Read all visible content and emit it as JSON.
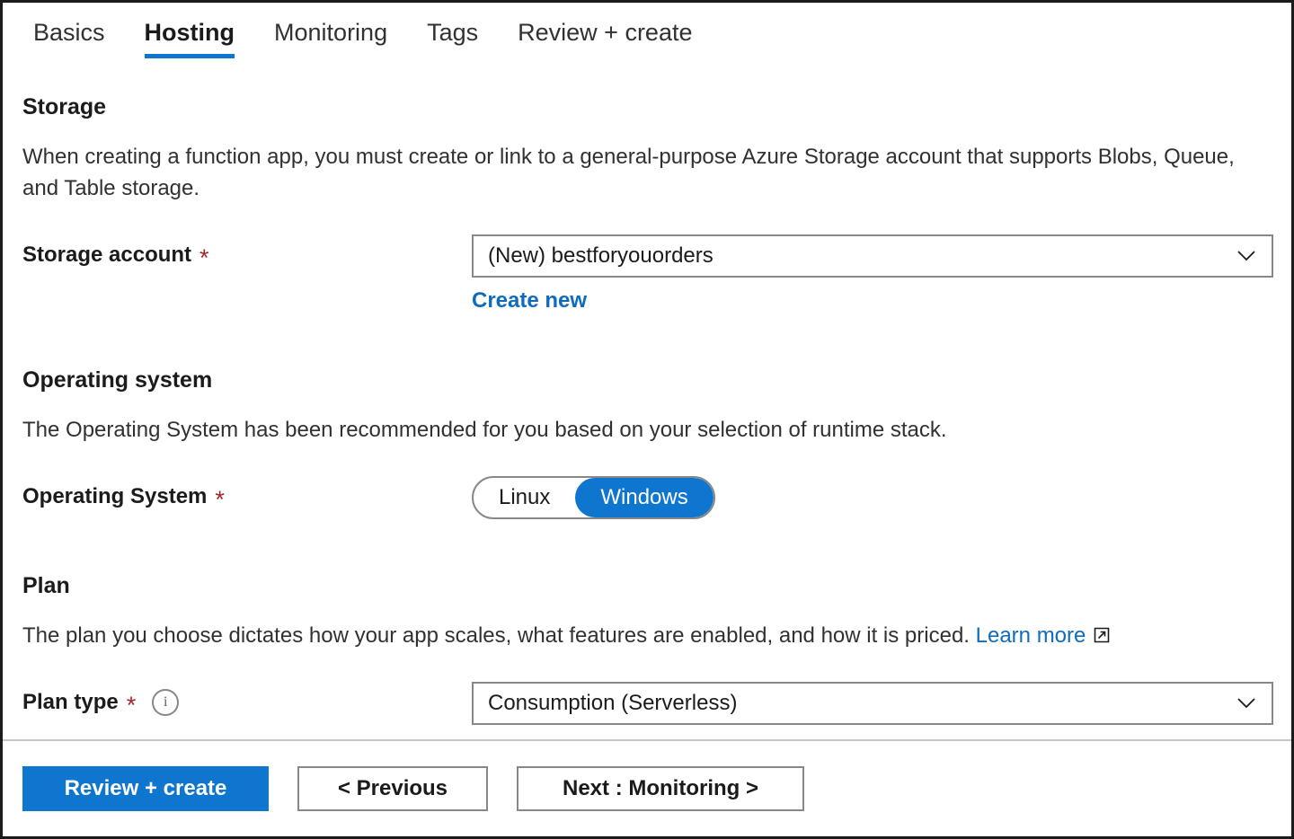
{
  "tabs": [
    {
      "label": "Basics",
      "active": false
    },
    {
      "label": "Hosting",
      "active": true
    },
    {
      "label": "Monitoring",
      "active": false
    },
    {
      "label": "Tags",
      "active": false
    },
    {
      "label": "Review + create",
      "active": false
    }
  ],
  "storage": {
    "heading": "Storage",
    "description": "When creating a function app, you must create or link to a general-purpose Azure Storage account that supports Blobs, Queue, and Table storage.",
    "account_label": "Storage account",
    "account_required": "*",
    "account_value": "(New) bestforyouorders",
    "create_new_label": "Create new"
  },
  "operating_system": {
    "heading": "Operating system",
    "description": "The Operating System has been recommended for you based on your selection of runtime stack.",
    "label": "Operating System",
    "required": "*",
    "options": [
      "Linux",
      "Windows"
    ],
    "selected": "Windows"
  },
  "plan": {
    "heading": "Plan",
    "description": "The plan you choose dictates how your app scales, what features are enabled, and how it is priced.",
    "learn_more_label": "Learn more",
    "type_label": "Plan type",
    "type_required": "*",
    "type_value": "Consumption (Serverless)"
  },
  "footer": {
    "review_create_label": "Review + create",
    "previous_label": "< Previous",
    "next_label": "Next : Monitoring >"
  },
  "colors": {
    "accent_blue": "#0f76d0",
    "link_blue": "#0f6cbd",
    "required_red": "#a4262c",
    "border_grey": "#8a8886",
    "text": "#1b1b1b"
  },
  "icons": {
    "chevron": "chevron-down-icon",
    "info": "info-icon",
    "external": "external-link-icon"
  }
}
